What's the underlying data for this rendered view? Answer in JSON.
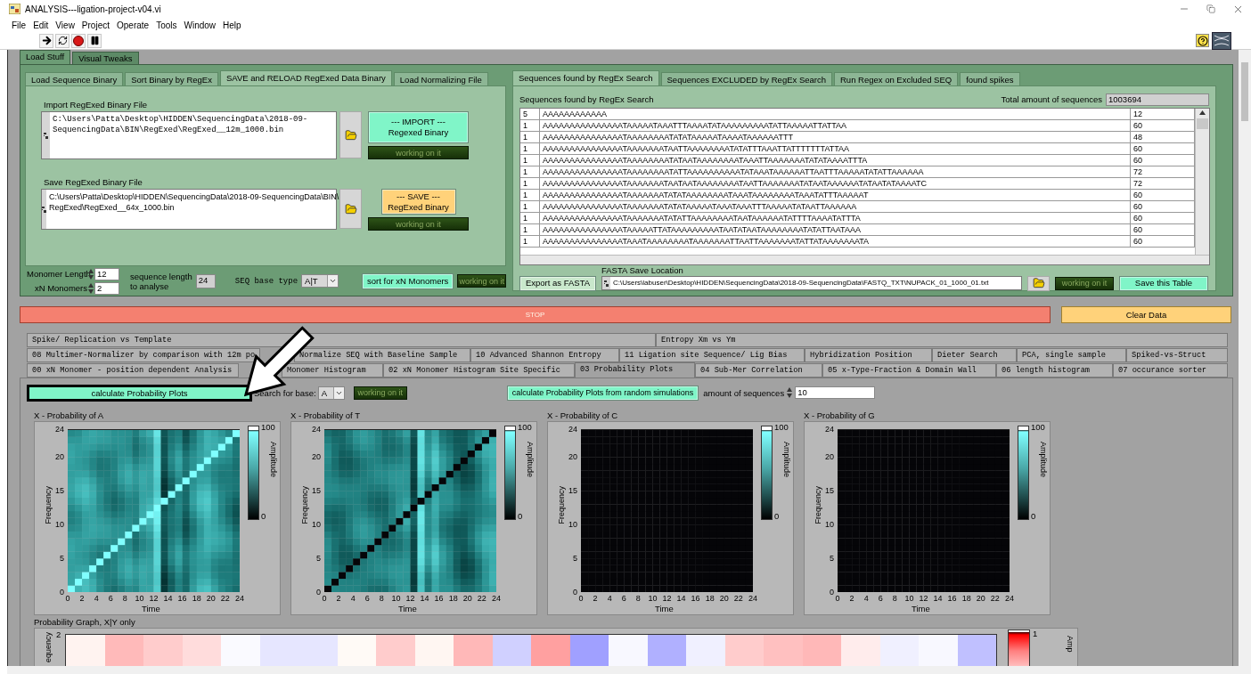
{
  "window": {
    "title": "ANALYSIS---ligation-project-v04.vi"
  },
  "menu": [
    "File",
    "Edit",
    "View",
    "Project",
    "Operate",
    "Tools",
    "Window",
    "Help"
  ],
  "outer_tabs": [
    {
      "label": "Load Stuff",
      "selected": true
    },
    {
      "label": "Visual Tweaks",
      "selected": false
    }
  ],
  "binary_tabs": [
    {
      "label": "Load Sequence Binary",
      "selected": false
    },
    {
      "label": "Sort Binary by RegEx",
      "selected": false
    },
    {
      "label": "SAVE and RELOAD RegExed Data Binary",
      "selected": true
    },
    {
      "label": "Load Normalizing File",
      "selected": false
    }
  ],
  "import_file": {
    "label": "Import RegExed Binary File",
    "path": "C:\\Users\\Patta\\Desktop\\HIDDEN\\SequencingData\\2018-09-\nSequencingData\\BIN\\RegExed\\RegExed__12m_1000.bin",
    "button": "--- IMPORT ---\nRegexed Binary",
    "indicator": "working on it"
  },
  "save_file": {
    "label": "Save RegExed Binary File",
    "path": "C:\\Users\\Patta\\Desktop\\HIDDEN\\SequencingData\\2018-09-SequencingData\\BIN\\\nRegExed\\RegExed__64x_1000.bin",
    "button": "--- SAVE ---\nRegExed Binary",
    "indicator": "working on it"
  },
  "monomer": {
    "length_label": "Monomer Length",
    "length": "12",
    "xn_label": "xN Monomers",
    "xn": "2",
    "seq_length_label": "sequence length\nto analyse",
    "seq_length": "24",
    "base_type_label": "SEQ base type",
    "base_type": "A|T",
    "sort_button": "sort for xN Monomers",
    "indicator": "working on it"
  },
  "sequence_tabs": [
    {
      "label": "Sequences found by RegEx Search",
      "selected": true
    },
    {
      "label": "Sequences EXCLUDED by RegEx Search",
      "selected": false
    },
    {
      "label": "Run Regex on Excluded SEQ",
      "selected": false
    },
    {
      "label": "found spikes",
      "selected": false
    }
  ],
  "sequences": {
    "title": "Sequences found by RegEx Search",
    "total_label": "Total amount of sequences",
    "total": "1003694",
    "rows": [
      {
        "count": "5",
        "sequence": "AAAAAAAAAAAA",
        "length": "12"
      },
      {
        "count": "1",
        "sequence": "AAAAAAAAAAAAAAATAAAAATAAATTTAAAATATAAAAAAAAATATTAAAAATTATTAA",
        "length": "60"
      },
      {
        "count": "1",
        "sequence": "AAAAAAAAAAAAAAATAAAAAAAATATATAAAAATAAAATAAAAAATTT",
        "length": "48"
      },
      {
        "count": "1",
        "sequence": "AAAAAAAAAAAAAAATAAAAAAATAATTAAAAAAAATATATTTAAATTATTTTTTTATTAA",
        "length": "60"
      },
      {
        "count": "1",
        "sequence": "AAAAAAAAAAAAAAATAAAAAAAATATAATAAAAAAAATAAATTAAAAAAATATATAAAATTTA",
        "length": "60"
      },
      {
        "count": "1",
        "sequence": "AAAAAAAAAAAAAAATAAAAAAAATATTAAAAAAAAAATATAAATAAAAAATTAATTTAAAAATATATTAAAAAA",
        "length": "72"
      },
      {
        "count": "1",
        "sequence": "AAAAAAAAAAAAAAATAAAAAAATAATAATAAAAAAAATAATTAAAAAAATATAATAAAAAATATAATATAAAATC",
        "length": "72"
      },
      {
        "count": "1",
        "sequence": "AAAAAAAAAAAAAAATAAAAAAATATATAAAAAAAATAAATAAAAAAAATAAATATTTAAAAAT",
        "length": "60"
      },
      {
        "count": "1",
        "sequence": "AAAAAAAAAAAAAAATAAAAAAATATATAAAAATAAATAAATTTAAAAATATAATTAAAAAA",
        "length": "60"
      },
      {
        "count": "1",
        "sequence": "AAAAAAAAAAAAAAATAAAAAAATATATTAAAAAAAATAATAAAAAATATTTTAAAATATTTA",
        "length": "60"
      },
      {
        "count": "1",
        "sequence": "AAAAAAAAAAAAAAATAAAAATTATAAAAAAAAATAATATAATAAAAAAAATATATTAATAAA",
        "length": "60"
      },
      {
        "count": "1",
        "sequence": "AAAAAAAAAAAAAAATAAATAAAAAAAATAAAAAAATTAATTAAAAAAATATTATAAAAAAATA",
        "length": "60"
      }
    ]
  },
  "fasta": {
    "export_button": "Export as FASTA",
    "location_label": "FASTA Save Location",
    "path": "C:\\Users\\labuser\\Desktop\\HIDDEN\\SequencingData\\2018-09-SequencingData\\FASTQ_TXT\\NUPACK_01_1000_01.txt",
    "indicator": "working on it",
    "save_button": "Save this Table"
  },
  "stop_button": "STOP",
  "clear_button": "Clear Data",
  "analysis_tabs": [
    {
      "tabs": [
        {
          "label": "Spike/ Replication vs Template",
          "selected": false
        },
        {
          "label": "Entropy Xm vs Ym",
          "selected": false
        }
      ]
    },
    {
      "tabs": [
        {
          "label": "08 Multimer-Normalizer by comparison with 12m po",
          "selected": false
        },
        {
          "label": "Normalize SEQ with Baseline Sample",
          "selected": false
        },
        {
          "label": "10 Advanced Shannon Entropy",
          "selected": false
        },
        {
          "label": "11 Ligation site Sequence/ Lig Bias",
          "selected": false
        },
        {
          "label": "Hybridization Position",
          "selected": false
        },
        {
          "label": "Dieter Search",
          "selected": false
        },
        {
          "label": "PCA, single sample",
          "selected": false
        },
        {
          "label": "Spiked-vs-Struct",
          "selected": false
        }
      ]
    },
    {
      "tabs": [
        {
          "label": "00 xN Monomer - position dependent Analysis",
          "selected": false
        },
        {
          "label": "Monomer Histogram",
          "selected": false
        },
        {
          "label": "02 xN Monomer Histogram Site Specific",
          "selected": false
        },
        {
          "label": "03 Probability Plots",
          "selected": true
        },
        {
          "label": "04 Sub-Mer Correlation",
          "selected": false
        },
        {
          "label": "05 x-Type-Fraction & Domain Wall",
          "selected": false
        },
        {
          "label": "06 length histogram",
          "selected": false
        },
        {
          "label": "07 occurance sorter",
          "selected": false
        }
      ]
    }
  ],
  "probability": {
    "calc_button": "calculate Probability Plots",
    "base_label": "Search for base:",
    "base": "A",
    "indicator": "working on it",
    "random_button": "calculate Probability Plots from random simulations",
    "amount_label": "amount of sequences",
    "amount": "10"
  },
  "heatmaps": [
    {
      "title": "X - Probability of A",
      "kind": "bright-diagonal",
      "xlabel": "Time",
      "ylabel": "Frequency",
      "xticks": [
        "0",
        "2",
        "4",
        "6",
        "8",
        "10",
        "12",
        "14",
        "16",
        "18",
        "20",
        "22",
        "24"
      ],
      "yticks": [
        "24",
        "20",
        "15",
        "10",
        "5",
        "0"
      ],
      "scale_label": "Amplitude",
      "scale_ticks": [
        "100",
        "0"
      ]
    },
    {
      "title": "X - Probability of T",
      "kind": "dark-diagonal",
      "xlabel": "Time",
      "ylabel": "Frequency",
      "xticks": [
        "0",
        "2",
        "4",
        "6",
        "8",
        "10",
        "12",
        "14",
        "16",
        "18",
        "20",
        "22",
        "24"
      ],
      "yticks": [
        "24",
        "20",
        "15",
        "10",
        "5",
        "0"
      ],
      "scale_label": "Amplitude",
      "scale_ticks": [
        "100",
        "0"
      ]
    },
    {
      "title": "X - Probability of C",
      "kind": "empty",
      "xlabel": "Time",
      "ylabel": "Frequency",
      "xticks": [
        "0",
        "2",
        "4",
        "6",
        "8",
        "10",
        "12",
        "14",
        "16",
        "18",
        "20",
        "22",
        "24"
      ],
      "yticks": [
        "24",
        "20",
        "15",
        "10",
        "5",
        "0"
      ],
      "scale_label": "Amplitude",
      "scale_ticks": [
        "100",
        "0"
      ]
    },
    {
      "title": "X - Probability of G",
      "kind": "empty",
      "xlabel": "Time",
      "ylabel": "Frequency",
      "xticks": [
        "0",
        "2",
        "4",
        "6",
        "8",
        "10",
        "12",
        "14",
        "16",
        "18",
        "20",
        "22",
        "24"
      ],
      "yticks": [
        "24",
        "20",
        "15",
        "10",
        "5",
        "0"
      ],
      "scale_label": "Amplitude",
      "scale_ticks": [
        "100",
        "0"
      ]
    }
  ],
  "probability_graph": {
    "title": "Probability Graph, X|Y only",
    "ylabel": "equency",
    "ytick": "2",
    "scale_tick": "1",
    "scale_label": "Amp",
    "cells": [
      {
        "color": "#fff3f0"
      },
      {
        "color": "#ffbaba"
      },
      {
        "color": "#ffcccc"
      },
      {
        "color": "#ffdcdc"
      },
      {
        "color": "#fafaff"
      },
      {
        "color": "#e6e6ff"
      },
      {
        "color": "#e6e6ff"
      },
      {
        "color": "#fffaf6"
      },
      {
        "color": "#ffcccc"
      },
      {
        "color": "#fff6f2"
      },
      {
        "color": "#ffb8b8"
      },
      {
        "color": "#d0d0ff"
      },
      {
        "color": "#ffa0a0"
      },
      {
        "color": "#a0a0ff"
      },
      {
        "color": "#f8f8ff"
      },
      {
        "color": "#b0b0ff"
      },
      {
        "color": "#f0f0ff"
      },
      {
        "color": "#ffcccc"
      },
      {
        "color": "#ffc0c0"
      },
      {
        "color": "#ffb8b8"
      },
      {
        "color": "#ffecec"
      },
      {
        "color": "#f0f0ff"
      },
      {
        "color": "#f8f8ff"
      },
      {
        "color": "#c0c0ff"
      }
    ]
  }
}
